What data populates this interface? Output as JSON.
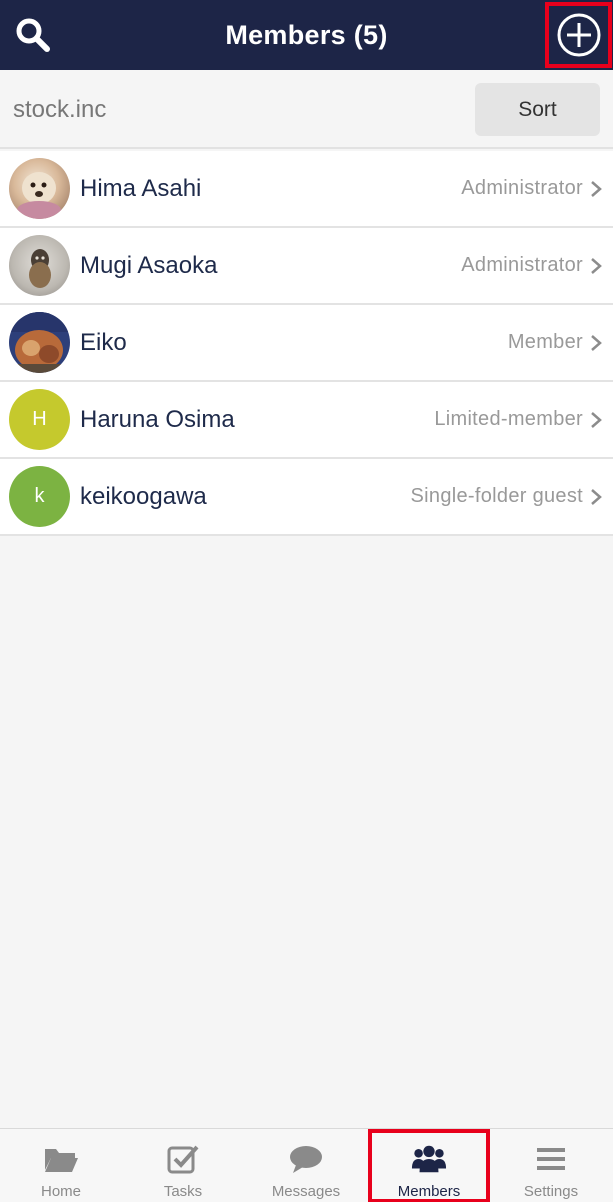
{
  "header": {
    "title": "Members (5)"
  },
  "subbar": {
    "organization": "stock.inc",
    "sort_label": "Sort"
  },
  "members": [
    {
      "name": "Hima Asahi",
      "role": "Administrator",
      "avatar_initial": "",
      "avatar_color": "#c9a88a"
    },
    {
      "name": "Mugi Asaoka",
      "role": "Administrator",
      "avatar_initial": "",
      "avatar_color": "#8e8a84"
    },
    {
      "name": "Eiko",
      "role": "Member",
      "avatar_initial": "",
      "avatar_color": "#2d3f7a"
    },
    {
      "name": "Haruna Osima",
      "role": "Limited-member",
      "avatar_initial": "H",
      "avatar_color": "#c5c92d"
    },
    {
      "name": "keikoogawa",
      "role": "Single-folder guest",
      "avatar_initial": "k",
      "avatar_color": "#7cb342"
    }
  ],
  "tabs": [
    {
      "label": "Home",
      "icon": "folder-icon",
      "active": false
    },
    {
      "label": "Tasks",
      "icon": "checkbox-icon",
      "active": false
    },
    {
      "label": "Messages",
      "icon": "chat-bubble-icon",
      "active": false
    },
    {
      "label": "Members",
      "icon": "people-icon",
      "active": true
    },
    {
      "label": "Settings",
      "icon": "hamburger-icon",
      "active": false
    }
  ],
  "colors": {
    "header_bg": "#1d2547",
    "highlight_border": "#e8001c",
    "inactive_icon": "#8a8a8a",
    "active_icon": "#1d2547"
  }
}
